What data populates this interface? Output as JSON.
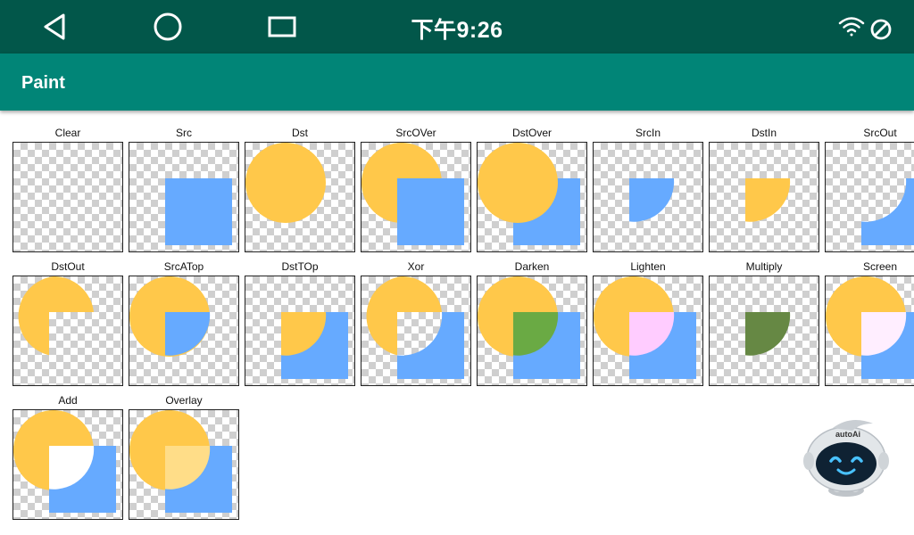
{
  "status_bar": {
    "time": "下午9:26",
    "icons": [
      "back-triangle-icon",
      "home-circle-icon",
      "recent-square-icon",
      "wifi-icon",
      "no-signal-icon"
    ]
  },
  "app_bar": {
    "title": "Paint"
  },
  "colors": {
    "circle": "#ffc84a",
    "square": "#66aaff",
    "status_bar": "#02574a",
    "app_bar": "#018577"
  },
  "modes": [
    {
      "label": "Clear",
      "mode": "clear"
    },
    {
      "label": "Src",
      "mode": "src"
    },
    {
      "label": "Dst",
      "mode": "dst"
    },
    {
      "label": "SrcOVer",
      "mode": "srcover"
    },
    {
      "label": "DstOver",
      "mode": "dstover"
    },
    {
      "label": "SrcIn",
      "mode": "srcin"
    },
    {
      "label": "DstIn",
      "mode": "dstin"
    },
    {
      "label": "SrcOut",
      "mode": "srcout"
    },
    {
      "label": "DstOut",
      "mode": "dstout"
    },
    {
      "label": "SrcATop",
      "mode": "srcatop"
    },
    {
      "label": "DstTOp",
      "mode": "dstatop"
    },
    {
      "label": "Xor",
      "mode": "xor"
    },
    {
      "label": "Darken",
      "mode": "darken"
    },
    {
      "label": "Lighten",
      "mode": "lighten"
    },
    {
      "label": "Multiply",
      "mode": "multiply"
    },
    {
      "label": "Screen",
      "mode": "screen"
    },
    {
      "label": "Add",
      "mode": "add"
    },
    {
      "label": "Overlay",
      "mode": "overlay"
    }
  ],
  "mascot": {
    "brand": "autoAi"
  }
}
